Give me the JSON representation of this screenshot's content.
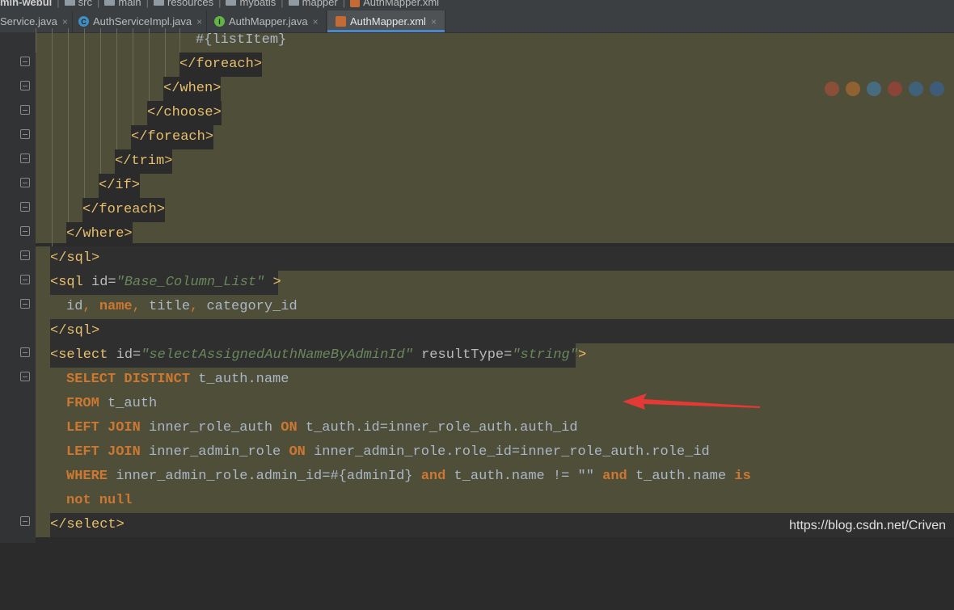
{
  "breadcrumb": [
    {
      "label": "min-webui",
      "icon": ""
    },
    {
      "label": "src",
      "icon": "folder-icon"
    },
    {
      "label": "main",
      "icon": "folder-icon"
    },
    {
      "label": "resources",
      "icon": "folder-icon"
    },
    {
      "label": "mybatis",
      "icon": "folder-icon"
    },
    {
      "label": "mapper",
      "icon": "folder-icon"
    },
    {
      "label": "AuthMapper.xml",
      "icon": "xml-file-icon"
    }
  ],
  "tabs": [
    {
      "label": "Service.java",
      "close": "×",
      "icon": ""
    },
    {
      "label": "AuthServiceImpl.java",
      "close": "×",
      "icon": "class-icon",
      "glyph": "C"
    },
    {
      "label": "AuthMapper.java",
      "close": "×",
      "icon": "interface-icon",
      "glyph": "I"
    },
    {
      "label": "AuthMapper.xml",
      "close": "×",
      "icon": "xml-file-icon",
      "glyph": "&lt;"
    }
  ],
  "code": [
    "#{listItem}",
    "</foreach>",
    "</when>",
    "</choose>",
    "</foreach>",
    "</trim>",
    "</if>",
    "</foreach>",
    "</where>",
    "</sql>",
    "<sql id=\"Base_Column_List\" >",
    "id, name, title, category_id",
    "</sql>",
    "<select id=\"selectAssignedAuthNameByAdminId\" resultType=\"string\">",
    "SELECT DISTINCT t_auth.name",
    "FROM t_auth",
    "LEFT JOIN inner_role_auth ON t_auth.id=inner_role_auth.auth_id",
    "LEFT JOIN inner_admin_role ON inner_admin_role.role_id=inner_role_auth.role_id",
    "WHERE inner_admin_role.admin_id=#{adminId} and t_auth.name != \"\" and t_auth.name is",
    "not null",
    "</select>"
  ],
  "browser_icons": [
    "chrome-icon",
    "firefox-icon",
    "safari-icon",
    "opera-icon",
    "ie-icon",
    "edge-icon"
  ],
  "watermark": "https://blog.csdn.net/Criven",
  "colors": {
    "accent": "#4a88c7",
    "arrow": "#e53935",
    "highlight_band": "#4f4e38"
  }
}
